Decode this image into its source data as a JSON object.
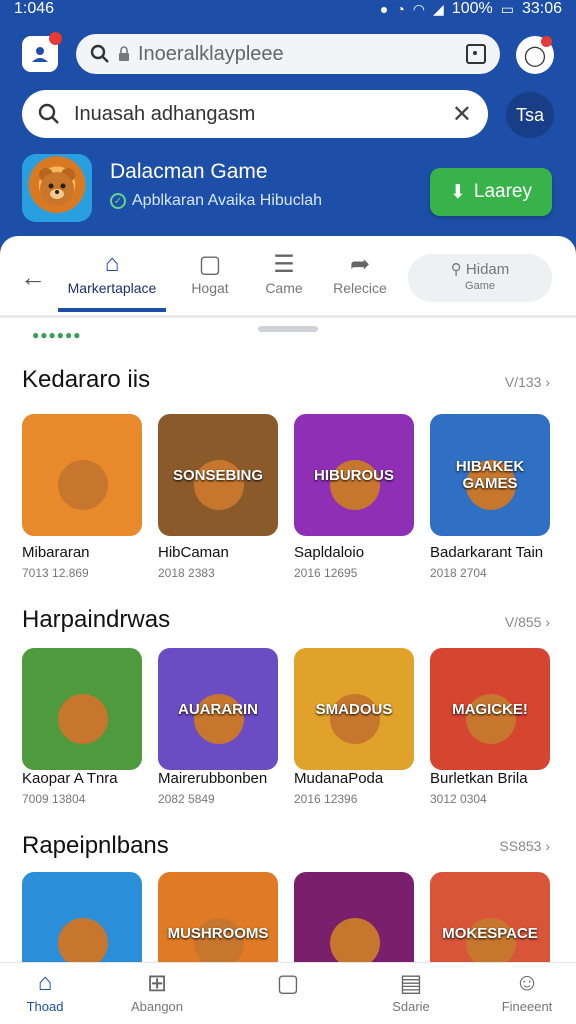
{
  "status": {
    "time": "1:046",
    "battery": "100%",
    "clock": "33:06"
  },
  "topbar": {
    "url_text": "Inoeralklaypleee",
    "account_label": "Tsa"
  },
  "search": {
    "value": "Inuasah adhangasm"
  },
  "app": {
    "title": "Dalacman Game",
    "subtitle": "Apblkaran Avaika Hibuclah",
    "install_label": "Laarey"
  },
  "tabs": {
    "items": [
      {
        "label": "Markertaplace",
        "icon": "home-icon"
      },
      {
        "label": "Hogat",
        "icon": "gamepad-icon"
      },
      {
        "label": "Came",
        "icon": "list-icon"
      },
      {
        "label": "Relecice",
        "icon": "share-icon"
      }
    ],
    "find": {
      "label": "Hidam",
      "sub": "Game"
    }
  },
  "sections": [
    {
      "title": "Kedararo iis",
      "more": "V/133",
      "items": [
        {
          "name": "Mibararan",
          "meta": "7013 12.869",
          "caption": "",
          "color": "#e8892b"
        },
        {
          "name": "HibCaman",
          "meta": "2018 2383",
          "caption": "SONSEBING",
          "color": "#8b5a2b"
        },
        {
          "name": "Sapldaloio",
          "meta": "2016 12695",
          "caption": "HIBUROUS",
          "color": "#8e2fb5"
        },
        {
          "name": "Badarkarant Tain",
          "meta": "2018 2704",
          "caption": "HIBAKEK GAMES",
          "color": "#2f6fc4"
        }
      ]
    },
    {
      "title": "Harpaindrwas",
      "more": "V/855",
      "items": [
        {
          "name": "Kaopar A Tnra",
          "meta": "7009 13804",
          "caption": "",
          "color": "#4f9a3c"
        },
        {
          "name": "Mairerubbonben",
          "meta": "2082 5849",
          "caption": "AUARARIN",
          "color": "#6b4cc2"
        },
        {
          "name": "MudanaPoda",
          "meta": "2016 12396",
          "caption": "SMADOUS",
          "color": "#e0a22a"
        },
        {
          "name": "Burletkan Brila",
          "meta": "3012 0304",
          "caption": "MAGICKE!",
          "color": "#d6452f"
        }
      ]
    },
    {
      "title": "Rapeipnlbans",
      "more": "SS853",
      "items": [
        {
          "name": "",
          "meta": "",
          "caption": "",
          "color": "#2a8fd8"
        },
        {
          "name": "",
          "meta": "",
          "caption": "MUSHROOMS",
          "color": "#e07a24"
        },
        {
          "name": "",
          "meta": "",
          "caption": "",
          "color": "#7a1f6b"
        },
        {
          "name": "",
          "meta": "",
          "caption": "MOKESPACE",
          "color": "#d8553a"
        }
      ]
    }
  ],
  "bottom_nav": [
    {
      "label": "Thoad",
      "icon": "home-icon"
    },
    {
      "label": "Abangon",
      "icon": "controller-icon"
    },
    {
      "label": "",
      "icon": "square-icon"
    },
    {
      "label": "Sdarie",
      "icon": "document-icon"
    },
    {
      "label": "Fineeent",
      "icon": "profile-icon"
    }
  ]
}
